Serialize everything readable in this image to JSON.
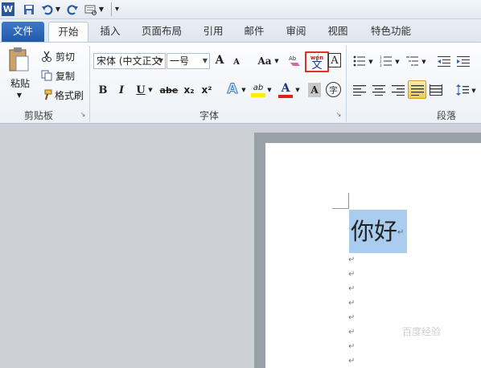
{
  "qat": {
    "icons": [
      "word-logo-icon",
      "save-icon",
      "undo-icon",
      "dropdown-arrow-icon",
      "redo-icon",
      "print-preview-icon",
      "customize-qat-icon"
    ]
  },
  "tabs": [
    {
      "label": "文件",
      "type": "file"
    },
    {
      "label": "开始",
      "type": "active"
    },
    {
      "label": "插入"
    },
    {
      "label": "页面布局"
    },
    {
      "label": "引用"
    },
    {
      "label": "邮件"
    },
    {
      "label": "审阅"
    },
    {
      "label": "视图"
    },
    {
      "label": "特色功能"
    }
  ],
  "clipboard": {
    "paste_label": "粘贴",
    "cut_label": "剪切",
    "copy_label": "复制",
    "format_painter_label": "格式刷",
    "group_label": "剪贴板"
  },
  "font": {
    "font_name": "宋体 (中文正文",
    "font_size": "一号",
    "grow": "A",
    "shrink": "A",
    "change_case": "Aa",
    "phonetic_top": "wén",
    "phonetic_char": "文",
    "border_char": "A",
    "bold": "B",
    "italic": "I",
    "underline": "U",
    "strike": "abe",
    "subscript": "x₂",
    "superscript": "x²",
    "effects": "A",
    "highlight": "ab",
    "font_color": "A",
    "shading": "A",
    "enclose": "字",
    "group_label": "字体"
  },
  "paragraph": {
    "group_label": "段落"
  },
  "document": {
    "text": "你好",
    "para_mark": "↵"
  },
  "colors": {
    "file_tab": "#2a64b5",
    "selection": "#a9ccef",
    "highlight_box": "#e0302a",
    "font_color_bar": "#e02020",
    "highlight_bar": "#ffee00"
  },
  "watermark": {
    "text": "百度经验"
  }
}
